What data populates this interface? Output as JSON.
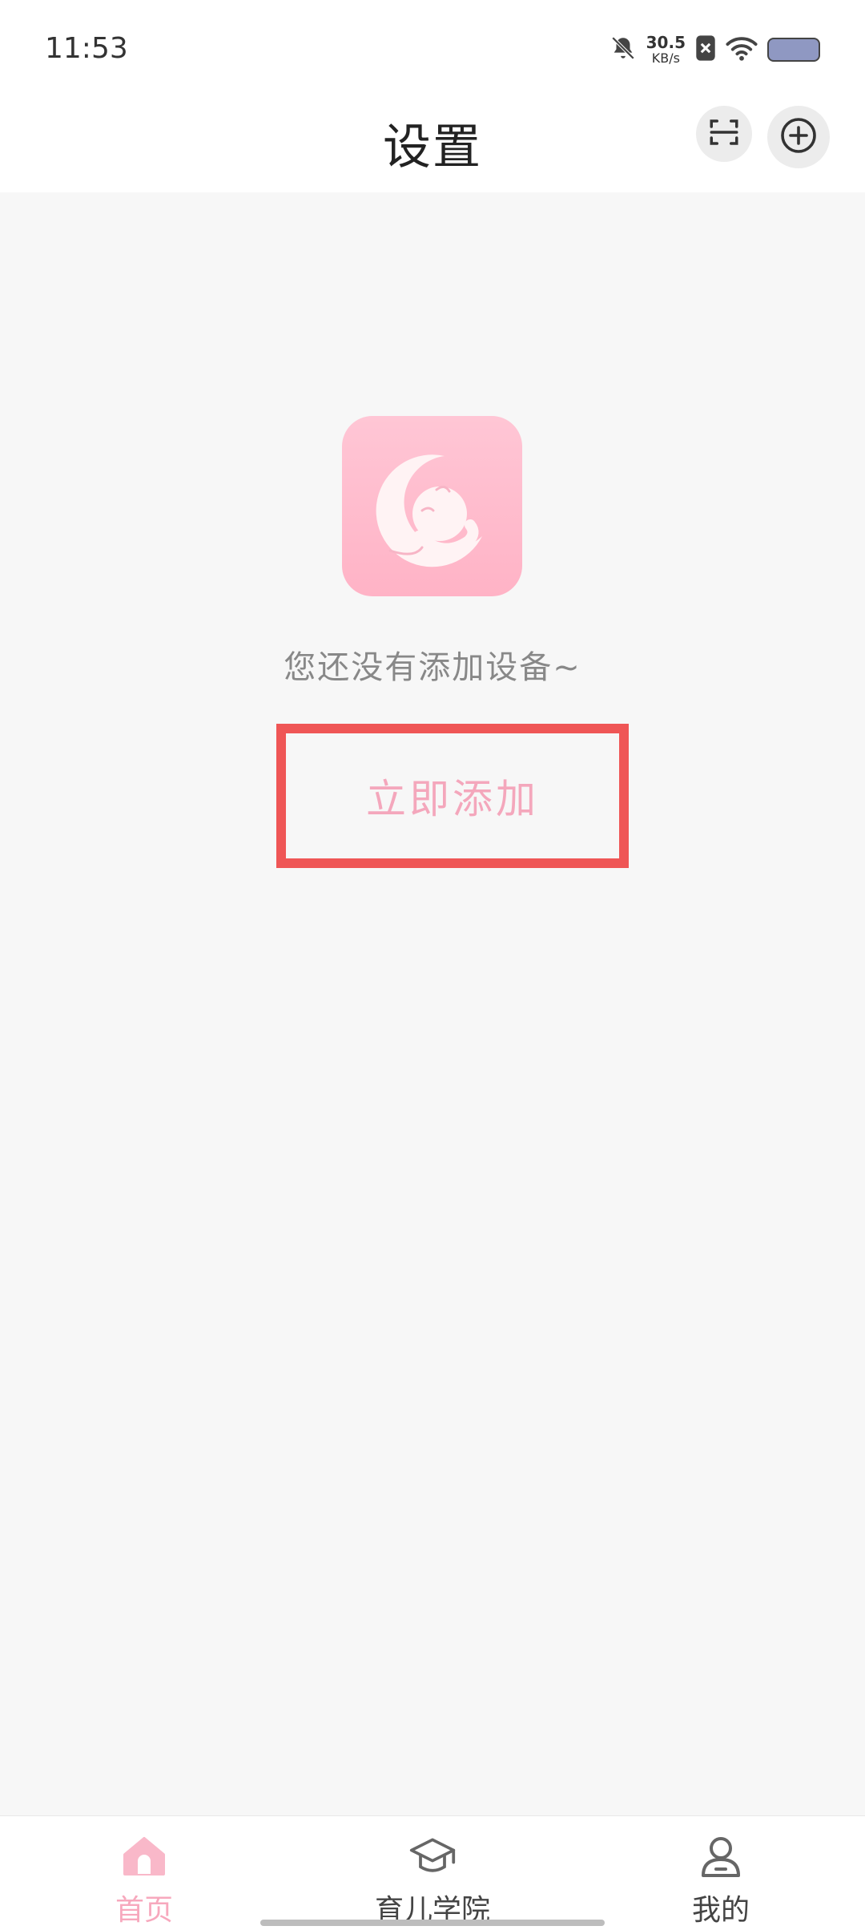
{
  "status_bar": {
    "time": "11:53",
    "net_speed_value": "30.5",
    "net_speed_unit": "KB/s",
    "icons": [
      "bell-muted-icon",
      "sim-blocked-icon",
      "wifi-icon",
      "battery-icon"
    ]
  },
  "header": {
    "title": "设置",
    "actions": [
      "scan-icon",
      "add-circle-icon"
    ]
  },
  "empty_state": {
    "logo": "baby-moon-logo",
    "message": "您还没有添加设备~",
    "button_label": "立即添加"
  },
  "bottom_nav": {
    "items": [
      {
        "label": "首页",
        "icon": "home-icon",
        "active": true
      },
      {
        "label": "育儿学院",
        "icon": "graduation-cap-icon",
        "active": false
      },
      {
        "label": "我的",
        "icon": "user-icon",
        "active": false
      }
    ]
  },
  "colors": {
    "accent_pink": "#f4a7bc",
    "highlight_border": "#ef5656",
    "background": "#f7f7f7"
  }
}
